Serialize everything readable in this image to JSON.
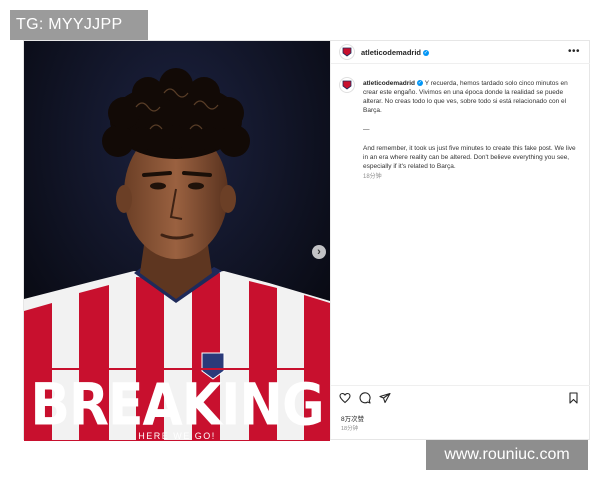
{
  "watermark_top": "TG: MYYJJPP",
  "watermark_bottom": "www.rouniuc.com",
  "media": {
    "headline": "BREAKING",
    "subline": "HERE WE GO!",
    "next_icon": "chevron-right-icon"
  },
  "header": {
    "username": "atleticodemadrid",
    "more_icon": "more-icon"
  },
  "caption": {
    "username": "atleticodemadrid",
    "spanish": "Y recuerda, hemos tardado solo cinco minutos en crear este engaño. Vivimos en una época donde la realidad se puede alterar. No creas todo lo que ves, sobre todo si está relacionado con el Barça.",
    "separator": "—",
    "english": "And remember, it took us just five minutes to create this fake post. We live in an era where reality can be altered. Don't believe everything you see, especially if it's related to Barça.",
    "time": "18分钟"
  },
  "footer": {
    "likes": "8万次赞",
    "posted": "18分钟"
  },
  "colors": {
    "verified": "#0095f6",
    "kit_red": "#c8102e",
    "media_bg": "#0b0d18"
  }
}
